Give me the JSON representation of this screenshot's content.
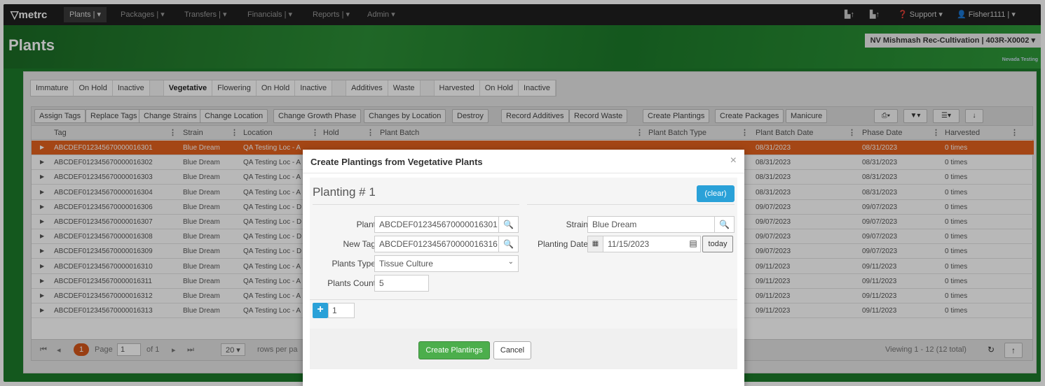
{
  "navbar": {
    "logo": "metrc",
    "items": [
      "Plants |",
      "Packages |",
      "Transfers |",
      "Financials |",
      "Reports |",
      "Admin"
    ],
    "right": {
      "support": "Support",
      "user": "Fisher1111"
    }
  },
  "banner": {
    "title": "Plants",
    "facility": "NV Mishmash Rec-Cultivation | 403R-X0002",
    "facility_sub": "Nevada Testing"
  },
  "tabs": {
    "group1": [
      "Immature",
      "On Hold",
      "Inactive"
    ],
    "group2": [
      "Vegetative",
      "Flowering",
      "On Hold",
      "Inactive"
    ],
    "group3": [
      "Additives",
      "Waste"
    ],
    "group4": [
      "Harvested",
      "On Hold",
      "Inactive"
    ]
  },
  "toolbar": {
    "buttons": [
      "Assign Tags",
      "Replace Tags",
      "Change Strains",
      "Change Location",
      "Change Growth Phase",
      "Changes by Location",
      "Destroy",
      "Record Additives",
      "Record Waste",
      "Create Plantings",
      "Create Packages",
      "Manicure"
    ]
  },
  "grid": {
    "headers": [
      "Tag",
      "Strain",
      "Location",
      "Hold",
      "Plant Batch",
      "Plant Batch Type",
      "Plant Batch Date",
      "Phase Date",
      "Harvested"
    ],
    "rows": [
      {
        "tag": "ABCDEF012345670000016301",
        "strain": "Blue Dream",
        "location": "QA Testing Loc - A",
        "batch_date": "08/31/2023",
        "phase_date": "08/31/2023",
        "harvested": "0 times"
      },
      {
        "tag": "ABCDEF012345670000016302",
        "strain": "Blue Dream",
        "location": "QA Testing Loc - A",
        "batch_date": "08/31/2023",
        "phase_date": "08/31/2023",
        "harvested": "0 times"
      },
      {
        "tag": "ABCDEF012345670000016303",
        "strain": "Blue Dream",
        "location": "QA Testing Loc - A",
        "batch_date": "08/31/2023",
        "phase_date": "08/31/2023",
        "harvested": "0 times"
      },
      {
        "tag": "ABCDEF012345670000016304",
        "strain": "Blue Dream",
        "location": "QA Testing Loc - A",
        "batch_date": "08/31/2023",
        "phase_date": "08/31/2023",
        "harvested": "0 times"
      },
      {
        "tag": "ABCDEF012345670000016306",
        "strain": "Blue Dream",
        "location": "QA Testing Loc - D",
        "batch_date": "09/07/2023",
        "phase_date": "09/07/2023",
        "harvested": "0 times"
      },
      {
        "tag": "ABCDEF012345670000016307",
        "strain": "Blue Dream",
        "location": "QA Testing Loc - D",
        "batch_date": "09/07/2023",
        "phase_date": "09/07/2023",
        "harvested": "0 times"
      },
      {
        "tag": "ABCDEF012345670000016308",
        "strain": "Blue Dream",
        "location": "QA Testing Loc - D",
        "batch_date": "09/07/2023",
        "phase_date": "09/07/2023",
        "harvested": "0 times"
      },
      {
        "tag": "ABCDEF012345670000016309",
        "strain": "Blue Dream",
        "location": "QA Testing Loc - D",
        "batch_date": "09/07/2023",
        "phase_date": "09/07/2023",
        "harvested": "0 times"
      },
      {
        "tag": "ABCDEF012345670000016310",
        "strain": "Blue Dream",
        "location": "QA Testing Loc - A",
        "batch_date": "09/11/2023",
        "phase_date": "09/11/2023",
        "harvested": "0 times"
      },
      {
        "tag": "ABCDEF012345670000016311",
        "strain": "Blue Dream",
        "location": "QA Testing Loc - A",
        "batch_date": "09/11/2023",
        "phase_date": "09/11/2023",
        "harvested": "0 times"
      },
      {
        "tag": "ABCDEF012345670000016312",
        "strain": "Blue Dream",
        "location": "QA Testing Loc - A",
        "batch_date": "09/11/2023",
        "phase_date": "09/11/2023",
        "harvested": "0 times"
      },
      {
        "tag": "ABCDEF012345670000016313",
        "strain": "Blue Dream",
        "location": "QA Testing Loc - A",
        "batch_date": "09/11/2023",
        "phase_date": "09/11/2023",
        "harvested": "0 times"
      }
    ]
  },
  "pager": {
    "current": "1",
    "page_label": "Page",
    "page_value": "1",
    "of_label": "of 1",
    "page_size": "20",
    "rows_label": "rows per pa",
    "viewing": "Viewing 1 - 12 (12 total)"
  },
  "modal": {
    "title": "Create Plantings from Vegetative Plants",
    "close": "×",
    "planting_title": "Planting # 1",
    "clear_label": "(clear)",
    "plant_label": "Plant",
    "plant_value": "ABCDEF012345670000016301",
    "new_tag_label": "New Tag",
    "new_tag_value": "ABCDEF012345670000016316",
    "plants_type_label": "Plants Type",
    "plants_type_value": "Tissue Culture",
    "plants_count_label": "Plants Count",
    "plants_count_value": "5",
    "strain_label": "Strain",
    "strain_value": "Blue Dream",
    "planting_date_label": "Planting Date",
    "planting_date_value": "11/15/2023",
    "today_label": "today",
    "add_count": "1",
    "create_label": "Create Plantings",
    "cancel_label": "Cancel"
  },
  "colors": {
    "selected_row": "#e4611e",
    "primary": "#2aa1d8",
    "success": "#4cae4c",
    "navbar": "#1f1f1f"
  }
}
